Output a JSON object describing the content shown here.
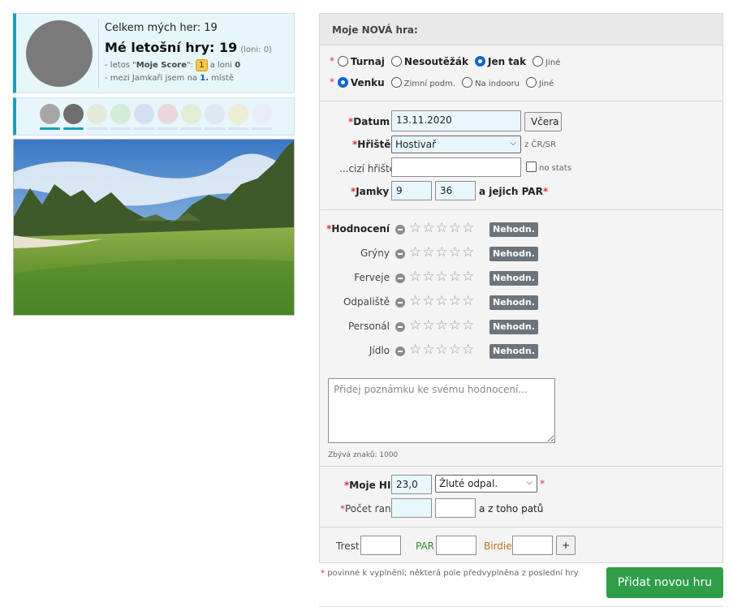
{
  "profile": {
    "games_total": "Celkem mých her: 19",
    "games_year": "Mé letošní hry: 19",
    "games_lastyear": "(loni: 0)",
    "score_prefix": "- letos \"",
    "score_name": "Moje Score",
    "score_mid": "\":",
    "score_badge": "1",
    "score_lastyear_text": "a loni",
    "score_lastyear_value": "0",
    "rank_prefix": "- mezi Jamkaři jsem na",
    "rank_value": "1.",
    "rank_suffix": "místě"
  },
  "swatches": [
    {
      "color": "#a6a6a6",
      "bar": "#17a2b8"
    },
    {
      "color": "#6e6e6e",
      "bar": "#17a2b8"
    },
    {
      "color": "#e4ead9",
      "bar": "#d6e6ec"
    },
    {
      "color": "#d2ecd9",
      "bar": "#d6e6ec"
    },
    {
      "color": "#d3e0f2",
      "bar": "#d6e6ec"
    },
    {
      "color": "#ecd6de",
      "bar": "#d6e6ec"
    },
    {
      "color": "#e3ecd6",
      "bar": "#d6e6ec"
    },
    {
      "color": "#dde8f2",
      "bar": "#d6e6ec"
    },
    {
      "color": "#eeedd5",
      "bar": "#d6e6ec"
    },
    {
      "color": "#e8eef3",
      "bar": "#d6e6ec"
    }
  ],
  "form": {
    "title": "Moje NOVÁ hra:",
    "game_types": [
      {
        "label": "Turnaj",
        "checked": false
      },
      {
        "label": "Nesoutěžák",
        "checked": false
      },
      {
        "label": "Jen tak",
        "checked": true
      },
      {
        "label": "Jiné",
        "checked": false
      }
    ],
    "venues": [
      {
        "label": "Venku",
        "checked": true
      },
      {
        "label": "Zimní podm.",
        "checked": false
      },
      {
        "label": "Na indooru",
        "checked": false
      },
      {
        "label": "Jiné",
        "checked": false
      }
    ],
    "date_label": "Datum",
    "date_value": "13.11.2020",
    "yesterday_button": "Včera",
    "course_label": "Hřiště",
    "course_value": "Hostivař",
    "course_region": "z ČR/SR",
    "foreign_label": "...cizí hřiště",
    "foreign_value": "",
    "no_stats_label": "no stats",
    "holes_label": "Jamky",
    "holes_value": "9",
    "par_value": "36",
    "par_label": "a jejich PAR",
    "ratings": [
      {
        "label": "Hodnocení",
        "main": true
      },
      {
        "label": "Grýny",
        "main": false
      },
      {
        "label": "Ferveje",
        "main": false
      },
      {
        "label": "Odpaliště",
        "main": false
      },
      {
        "label": "Personál",
        "main": false
      },
      {
        "label": "Jídlo",
        "main": false
      }
    ],
    "stars": "☆☆☆☆☆",
    "unrated_label": "Nehodn.",
    "note_placeholder": "Přidej poznámku ke svému hodnocení...",
    "chars_left": "Zbývá znaků: 1000",
    "hi_label": "Moje HI",
    "hi_value": "23,0",
    "tee_value": "Žluté odpal.",
    "strokes_label": "Počet ran",
    "strokes_value": "",
    "putts_value": "",
    "putts_label": "a z toho patů",
    "penalty_label": "Trest",
    "penalty_value": "",
    "par_count_label": "PAR",
    "par_count_value": "",
    "birdie_label": "Birdie",
    "birdie_value": "",
    "plus_button": "+"
  },
  "footnote": "povinné k vyplnění; některá pole předvyplněna z poslední hry",
  "submit_button": "Přidat novou hru",
  "colors": {
    "accent": "#17a2b8",
    "submit": "#2e9e49",
    "required": "#e0323d",
    "par_label": "#2e8b2e",
    "birdie_label": "#b8731e"
  }
}
